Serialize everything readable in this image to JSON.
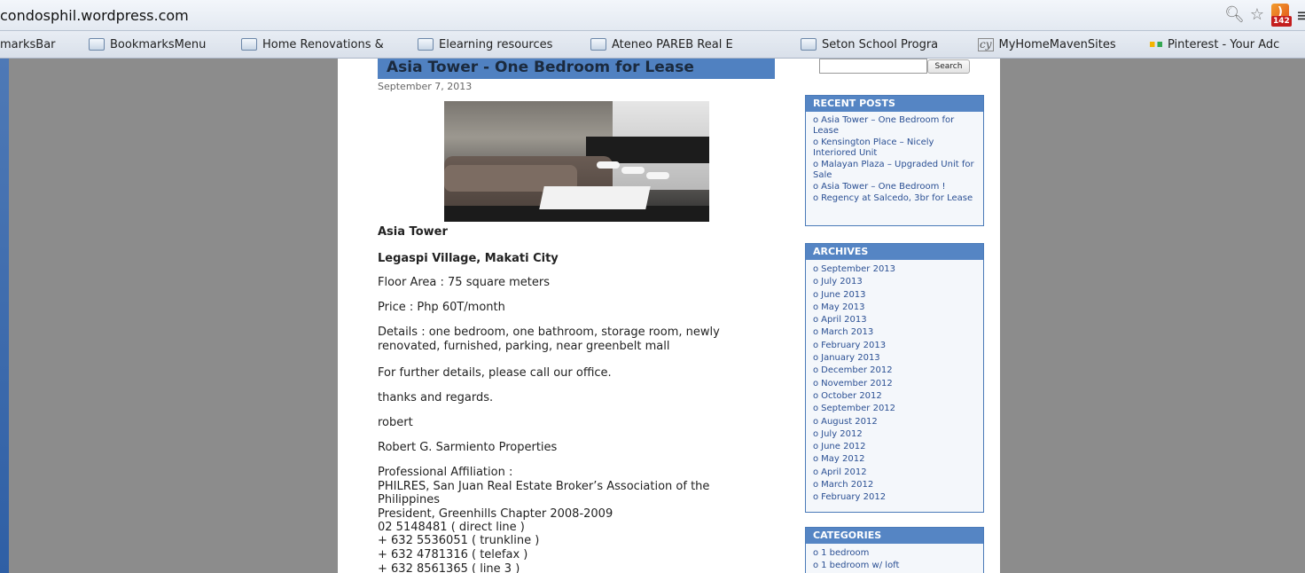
{
  "browser": {
    "url": "condosphil.wordpress.com",
    "rss_badge": "142",
    "bookmarks": [
      {
        "label": "marksBar",
        "icon": "none"
      },
      {
        "label": "BookmarksMenu",
        "icon": "folder-icon"
      },
      {
        "label": "Home Renovations &",
        "icon": "folder-icon"
      },
      {
        "label": "Elearning resources",
        "icon": "folder-icon"
      },
      {
        "label": "Ateneo PAREB Real E",
        "icon": "folder-icon"
      },
      {
        "label": "",
        "icon": "page-icon"
      },
      {
        "label": "Seton School Progra",
        "icon": "folder-icon"
      },
      {
        "label": "MyHomeMavenSites",
        "icon": "myhomemaven-icon"
      },
      {
        "label": "Pinterest - Your Adc",
        "icon": "pinterest-icon"
      }
    ]
  },
  "post": {
    "title": "Asia Tower - One Bedroom for Lease",
    "date": "September 7, 2013",
    "lines": [
      {
        "text": "Asia Tower",
        "bold": true
      },
      {
        "text": "Legaspi Village, Makati City",
        "bold": true
      },
      {
        "text": "Floor Area : 75 square meters"
      },
      {
        "text": "Price  : Php 60T/month"
      },
      {
        "text": "Details  : one bedroom, one bathroom, storage room, newly renovated, furnished, parking, near greenbelt mall"
      },
      {
        "text": "For further details, please call our office."
      },
      {
        "text": "thanks and regards."
      },
      {
        "text": "robert"
      },
      {
        "text": "Robert G. Sarmiento Properties"
      },
      {
        "text": "Professional Affiliation :"
      },
      {
        "text": "PHILRES, San Juan Real Estate Broker’s Association of the Philippines"
      },
      {
        "text": "President, Greenhills Chapter 2008-2009"
      },
      {
        "text": "02 5148481 ( direct line )"
      },
      {
        "text": "+ 632 5536051 ( trunkline )"
      },
      {
        "text": "+ 632 4781316 ( telefax )"
      },
      {
        "text": "+ 632 8561365 ( line 3 )"
      }
    ]
  },
  "sidebar": {
    "search_button": "Search",
    "recent_posts": {
      "title": "RECENT POSTS",
      "items": [
        "Asia Tower – One Bedroom for Lease",
        "Kensington Place – Nicely Interiored Unit",
        "Malayan Plaza – Upgraded Unit for Sale",
        "Asia Tower – One Bedroom !",
        "Regency at Salcedo, 3br for Lease"
      ]
    },
    "archives": {
      "title": "ARCHIVES",
      "items": [
        "September 2013",
        "July 2013",
        "June 2013",
        "May 2013",
        "April 2013",
        "March 2013",
        "February 2013",
        "January 2013",
        "December 2012",
        "November 2012",
        "October 2012",
        "September 2012",
        "August 2012",
        "July 2012",
        "June 2012",
        "May 2012",
        "April 2012",
        "March 2012",
        "February 2012"
      ]
    },
    "categories": {
      "title": "CATEGORIES",
      "items": [
        "1 bedroom",
        "1 bedroom w/ loft"
      ]
    }
  }
}
